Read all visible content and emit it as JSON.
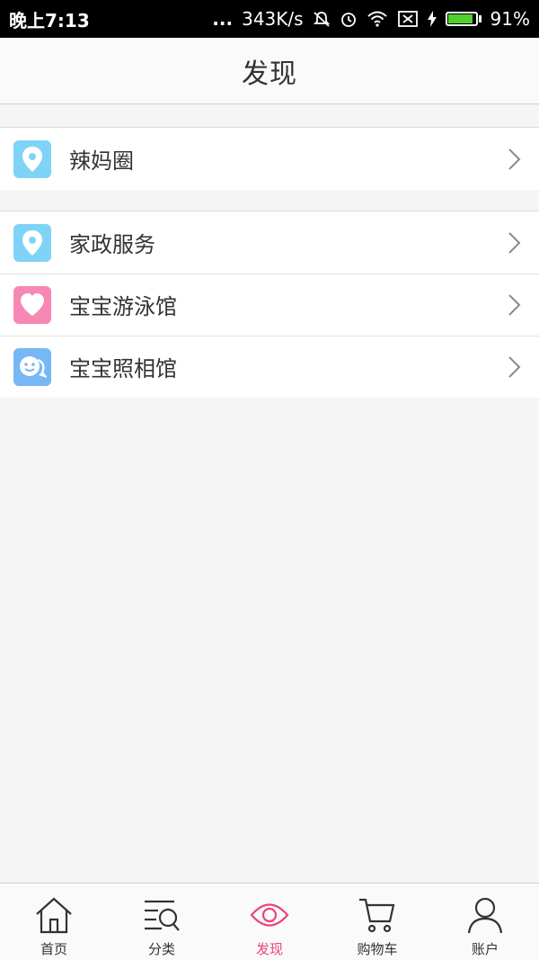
{
  "status_bar": {
    "time": "晚上7:13",
    "dots": "...",
    "speed": "343K/s",
    "battery_percent_text": "91%",
    "battery_level": 0.91,
    "battery_color": "#4fd12b"
  },
  "header": {
    "title": "发现"
  },
  "groups": [
    {
      "items": [
        {
          "label": "辣妈圈",
          "icon": "location-pin-icon",
          "icon_color": "#7fd3f7"
        }
      ]
    },
    {
      "items": [
        {
          "label": "家政服务",
          "icon": "location-pin-icon",
          "icon_color": "#7fd3f7"
        },
        {
          "label": "宝宝游泳馆",
          "icon": "heart-icon",
          "icon_color": "#f787b4"
        },
        {
          "label": "宝宝照相馆",
          "icon": "chat-face-icon",
          "icon_color": "#76b7f5"
        }
      ]
    }
  ],
  "tabbar": {
    "tabs": [
      {
        "label": "首页",
        "icon": "home-icon"
      },
      {
        "label": "分类",
        "icon": "category-search-icon"
      },
      {
        "label": "发现",
        "icon": "eye-icon",
        "active": true
      },
      {
        "label": "购物车",
        "icon": "cart-icon"
      },
      {
        "label": "账户",
        "icon": "user-icon"
      }
    ],
    "active_color": "#e9457a"
  }
}
